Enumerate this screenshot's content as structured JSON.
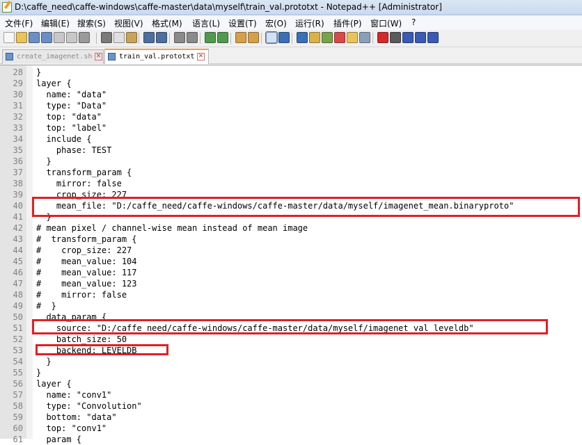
{
  "window": {
    "title": "D:\\caffe_need\\caffe-windows\\caffe-master\\data\\myself\\train_val.prototxt - Notepad++ [Administrator]"
  },
  "menu": [
    "文件(F)",
    "编辑(E)",
    "搜索(S)",
    "视图(V)",
    "格式(M)",
    "语言(L)",
    "设置(T)",
    "宏(O)",
    "运行(R)",
    "插件(P)",
    "窗口(W)",
    "?"
  ],
  "toolbar_icons": [
    "new-file-icon",
    "open-file-icon",
    "save-icon",
    "save-all-icon",
    "close-icon",
    "close-all-icon",
    "print-icon",
    "cut-icon",
    "copy-icon",
    "paste-icon",
    "undo-icon",
    "redo-icon",
    "find-icon",
    "replace-icon",
    "zoom-in-icon",
    "zoom-out-icon",
    "sync-vertical-icon",
    "sync-horizontal-icon",
    "word-wrap-icon",
    "show-all-chars-icon",
    "indent-guide-icon",
    "user-defined-language-icon",
    "document-map-icon",
    "function-list-icon",
    "folder-as-workspace-icon",
    "monitoring-icon",
    "record-macro-icon",
    "stop-recording-icon",
    "play-macro-icon",
    "run-macro-multiple-icon",
    "save-macro-icon"
  ],
  "tabs": [
    {
      "label": "create_imagenet.sh",
      "active": false
    },
    {
      "label": "train_val.prototxt",
      "active": true
    }
  ],
  "lines": [
    {
      "n": "28",
      "text": "}"
    },
    {
      "n": "29",
      "text": "layer {"
    },
    {
      "n": "30",
      "text": "  name: \"data\""
    },
    {
      "n": "31",
      "text": "  type: \"Data\""
    },
    {
      "n": "32",
      "text": "  top: \"data\""
    },
    {
      "n": "33",
      "text": "  top: \"label\""
    },
    {
      "n": "34",
      "text": "  include {"
    },
    {
      "n": "35",
      "text": "    phase: TEST"
    },
    {
      "n": "36",
      "text": "  }"
    },
    {
      "n": "37",
      "text": "  transform_param {"
    },
    {
      "n": "38",
      "text": "    mirror: false"
    },
    {
      "n": "39",
      "text": "    crop_size: 227"
    },
    {
      "n": "40",
      "text": "    mean_file: \"D:/caffe_need/caffe-windows/caffe-master/data/myself/imagenet_mean.binaryproto\""
    },
    {
      "n": "41",
      "text": "  }"
    },
    {
      "n": "42",
      "text": "# mean pixel / channel-wise mean instead of mean image"
    },
    {
      "n": "43",
      "text": "#  transform_param {"
    },
    {
      "n": "44",
      "text": "#    crop_size: 227"
    },
    {
      "n": "45",
      "text": "#    mean_value: 104"
    },
    {
      "n": "46",
      "text": "#    mean_value: 117"
    },
    {
      "n": "47",
      "text": "#    mean_value: 123"
    },
    {
      "n": "48",
      "text": "#    mirror: false"
    },
    {
      "n": "49",
      "text": "#  }"
    },
    {
      "n": "50",
      "text": "  data_param {"
    },
    {
      "n": "51",
      "text": "    source: \"D:/caffe_need/caffe-windows/caffe-master/data/myself/imagenet_val_leveldb\""
    },
    {
      "n": "52",
      "text": "    batch_size: 50"
    },
    {
      "n": "53",
      "text": "    backend: LEVELDB"
    },
    {
      "n": "54",
      "text": "  }"
    },
    {
      "n": "55",
      "text": "}"
    },
    {
      "n": "56",
      "text": "layer {"
    },
    {
      "n": "57",
      "text": "  name: \"conv1\""
    },
    {
      "n": "58",
      "text": "  type: \"Convolution\""
    },
    {
      "n": "59",
      "text": "  bottom: \"data\""
    },
    {
      "n": "60",
      "text": "  top: \"conv1\""
    },
    {
      "n": "61",
      "text": "  param {"
    }
  ],
  "colors": {
    "highlight_box": "#e01f26",
    "gutter": "#e4e4e4",
    "line_number": "#808080"
  }
}
